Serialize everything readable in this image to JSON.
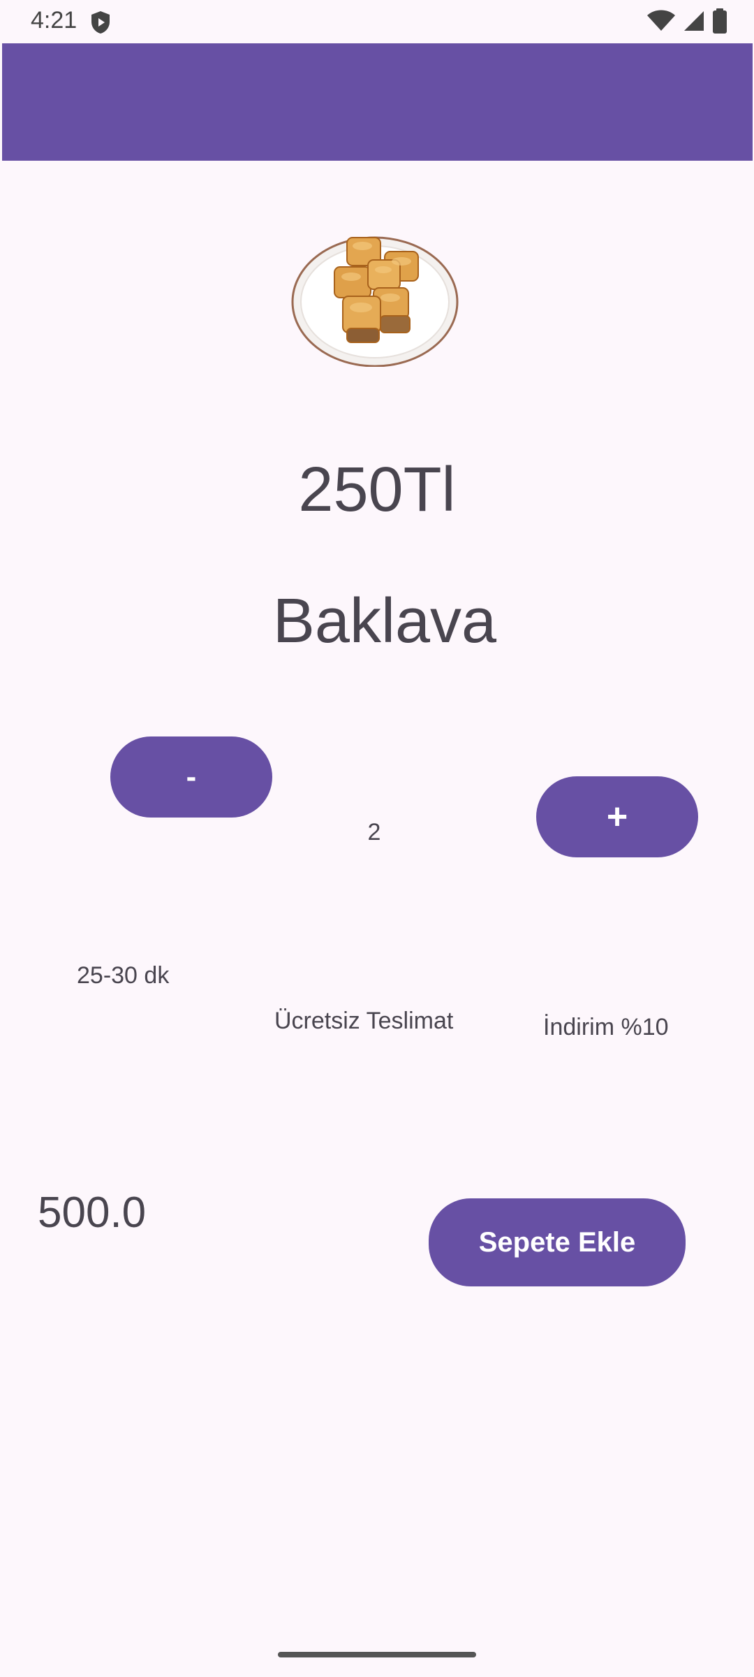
{
  "status_bar": {
    "time": "4:21",
    "icons": [
      "shield-icon",
      "wifi-icon",
      "signal-icon",
      "battery-icon"
    ]
  },
  "app_bar": {
    "color": "#6750a4"
  },
  "product": {
    "image_icon": "baklava-image",
    "price": "250Tl",
    "name": "Baklava"
  },
  "quantity": {
    "minus_label": "-",
    "value": "2",
    "plus_label": "+"
  },
  "info": {
    "delivery_time": "25-30 dk",
    "delivery_fee": "Ücretsiz Teslimat",
    "discount": "İndirim %10"
  },
  "footer": {
    "total": "500.0",
    "add_to_cart_label": "Sepete Ekle"
  },
  "colors": {
    "primary": "#6750a4",
    "background": "#fdf7fc",
    "text": "#49454f"
  }
}
